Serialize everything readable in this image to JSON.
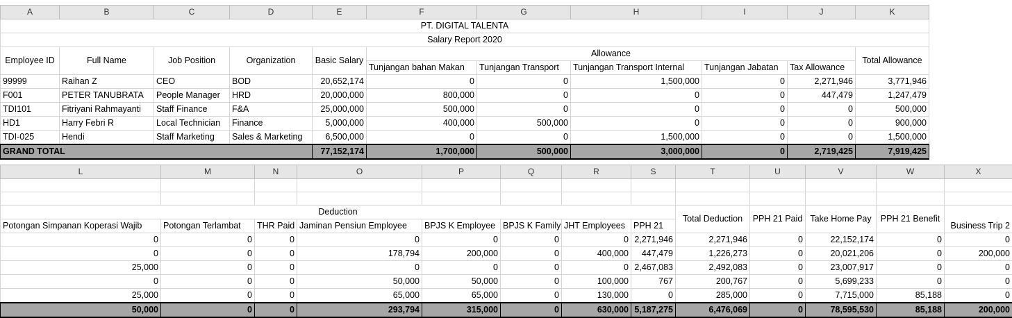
{
  "top": {
    "col_letters": [
      "A",
      "B",
      "C",
      "D",
      "E",
      "F",
      "G",
      "H",
      "I",
      "J",
      "K"
    ],
    "company": "PT. DIGITAL TALENTA",
    "report_title": "Salary Report 2020",
    "headers": {
      "employee_id": "Employee ID",
      "full_name": "Full Name",
      "job_position": "Job Position",
      "organization": "Organization",
      "basic_salary": "Basic Salary",
      "allowance": "Allowance",
      "total_allowance": "Total Allowance",
      "sub": [
        "Tunjangan bahan Makan",
        "Tunjangan Transport",
        "Tunjangan Transport Internal",
        "Tunjangan Jabatan",
        "Tax Allowance"
      ]
    },
    "rows": [
      [
        "99999",
        "Raihan Z",
        "CEO",
        "BOD",
        "20,652,174",
        "0",
        "0",
        "1,500,000",
        "0",
        "2,271,946",
        "3,771,946"
      ],
      [
        "F001",
        "PETER TANUBRATA",
        "People Manager",
        "HRD",
        "20,000,000",
        "800,000",
        "0",
        "0",
        "0",
        "447,479",
        "1,247,479"
      ],
      [
        "TDI101",
        "Fitriyani Rahmayanti",
        "Staff Finance",
        "F&A",
        "25,000,000",
        "500,000",
        "0",
        "0",
        "0",
        "0",
        "500,000"
      ],
      [
        "HD1",
        "Harry Febri R",
        "Local Technician",
        "Finance",
        "5,000,000",
        "400,000",
        "500,000",
        "0",
        "0",
        "0",
        "900,000"
      ],
      [
        "TDI-025",
        "Hendi",
        "Staff Marketing",
        "Sales & Marketing",
        "6,500,000",
        "0",
        "0",
        "1,500,000",
        "0",
        "0",
        "1,500,000"
      ]
    ],
    "total_label": "GRAND TOTAL",
    "totals": [
      "77,152,174",
      "1,700,000",
      "500,000",
      "3,000,000",
      "0",
      "2,719,425",
      "7,919,425"
    ]
  },
  "bottom": {
    "col_letters": [
      "L",
      "M",
      "N",
      "O",
      "P",
      "Q",
      "R",
      "S",
      "T",
      "U",
      "V",
      "W",
      "X"
    ],
    "deduction": "Deduction",
    "headers": [
      "Potongan Simpanan Koperasi Wajib",
      "Potongan Terlambat",
      "THR Paid",
      "Jaminan Pensiun Employee",
      "BPJS K Employee",
      "BPJS K Family",
      "JHT Employees",
      "PPH 21",
      "Total Deduction",
      "PPH 21 Paid",
      "Take Home Pay",
      "PPH 21 Benefit",
      "Business Trip 2"
    ],
    "rows": [
      [
        "0",
        "0",
        "0",
        "0",
        "0",
        "0",
        "0",
        "2,271,946",
        "2,271,946",
        "0",
        "22,152,174",
        "0",
        "0"
      ],
      [
        "0",
        "0",
        "0",
        "178,794",
        "200,000",
        "0",
        "400,000",
        "447,479",
        "1,226,273",
        "0",
        "20,021,206",
        "0",
        "200,000"
      ],
      [
        "25,000",
        "0",
        "0",
        "0",
        "0",
        "0",
        "0",
        "2,467,083",
        "2,492,083",
        "0",
        "23,007,917",
        "0",
        "0"
      ],
      [
        "0",
        "0",
        "0",
        "50,000",
        "50,000",
        "0",
        "100,000",
        "767",
        "200,767",
        "0",
        "5,699,233",
        "0",
        "0"
      ],
      [
        "25,000",
        "0",
        "0",
        "65,000",
        "65,000",
        "0",
        "130,000",
        "0",
        "285,000",
        "0",
        "7,715,000",
        "85,188",
        "0"
      ]
    ],
    "totals": [
      "50,000",
      "0",
      "0",
      "293,794",
      "315,000",
      "0",
      "630,000",
      "5,187,275",
      "6,476,069",
      "0",
      "78,595,530",
      "85,188",
      "200,000"
    ]
  }
}
